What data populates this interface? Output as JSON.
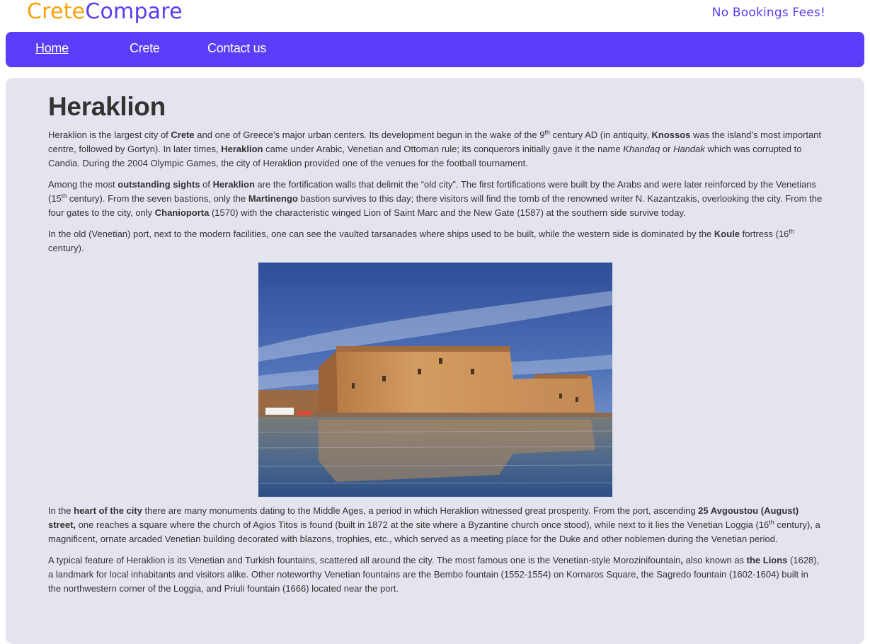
{
  "brand": {
    "part1": "Crete",
    "part2": "Compare",
    "colors": {
      "part1": "#f7a10d",
      "part2": "#5b3df2"
    }
  },
  "promo": "No Bookings Fees!",
  "nav": {
    "items": [
      {
        "label": "Home",
        "active": true
      },
      {
        "label": "Crete"
      },
      {
        "label": "Contact us"
      }
    ],
    "background": "#5b3df9"
  },
  "page": {
    "title": "Heraklion",
    "p1": {
      "t1": "Heraklion is the largest city of ",
      "b1": "Crete",
      "t2": " and one of Greece’s major urban centers. Its development begun in the wake of the 9",
      "sup1": "th",
      "t3": " century AD (in antiquity, ",
      "b2": "Knossos",
      "t4": " was the island’s most important centre, followed by Gortyn). In later times, ",
      "b3": "Heraklion",
      "t5": " came under Arabic, Venetian and Ottoman rule; its conquerors initially gave it the name ",
      "i1": "Khandaq",
      "t6": " or ",
      "i2": "Handak",
      "t7": " which was corrupted to Candia. During the 2004 Olympic Games, the city of Heraklion provided one of the venues for the football tournament."
    },
    "p2": {
      "t1": "Among the most ",
      "b1": "outstanding sights",
      "t2": " of ",
      "b2": "Heraklion",
      "t3": " are the fortification walls that delimit the “old city”. The first fortifications were built by the Arabs and were later reinforced by the Venetians (15",
      "sup1": "th",
      "t4": " century). From the seven bastions, only the ",
      "b3": "Martinengo",
      "t5": " bastion survives to this day; there visitors will find the tomb of the renowned writer N. Kazantzakis, overlooking the city. From the four gates to the city, only ",
      "b4": "Chanioporta",
      "t6": " (1570) with the characteristic winged Lion of Saint Marc and the New Gate (1587) at the southern side survive today."
    },
    "p3": {
      "t1": "In the old (Venetian) port, next to the modern facilities, one can see the vaulted tarsanades where ships used to be built, while the western side is dominated by the ",
      "b1": "Koule",
      "t2": " fortress (16",
      "sup1": "th",
      "t3": " century)."
    },
    "p4": {
      "t1": "In the ",
      "b1": "heart of the city",
      "t2": " there are many monuments dating to the Middle Ages, a period in which Heraklion witnessed great prosperity. From the port, ascending ",
      "b2": "25 Avgoustou (August) street,",
      "t3": " one reaches a square where the church of Agios Titos is found (built in 1872 at the site where a Byzantine church once stood), while next to it lies the Venetian Loggia (16",
      "sup1": "th",
      "t4": " century), a magnificent, ornate arcaded Venetian building decorated with blazons, trophies, etc., which served as a meeting place for the Duke and other noblemen during the Venetian period."
    },
    "p5": {
      "t1": "A typical feature of Heraklion is its Venetian and Turkish fountains, scattered all around the city. The most famous one is the Venetian-style Morozinifountain",
      "b1": ",",
      "t2": " also known as ",
      "b2": "the Lions",
      "t3": " (1628), a landmark for local inhabitants and visitors alike. Other noteworthy Venetian fountains are the Bembo fountain (1552-1554) on Kornaros Square, the Sagredo fountain (1602-1604) built in the northwestern corner of the Loggia, and Priuli fountain (1666) located near the port."
    }
  }
}
